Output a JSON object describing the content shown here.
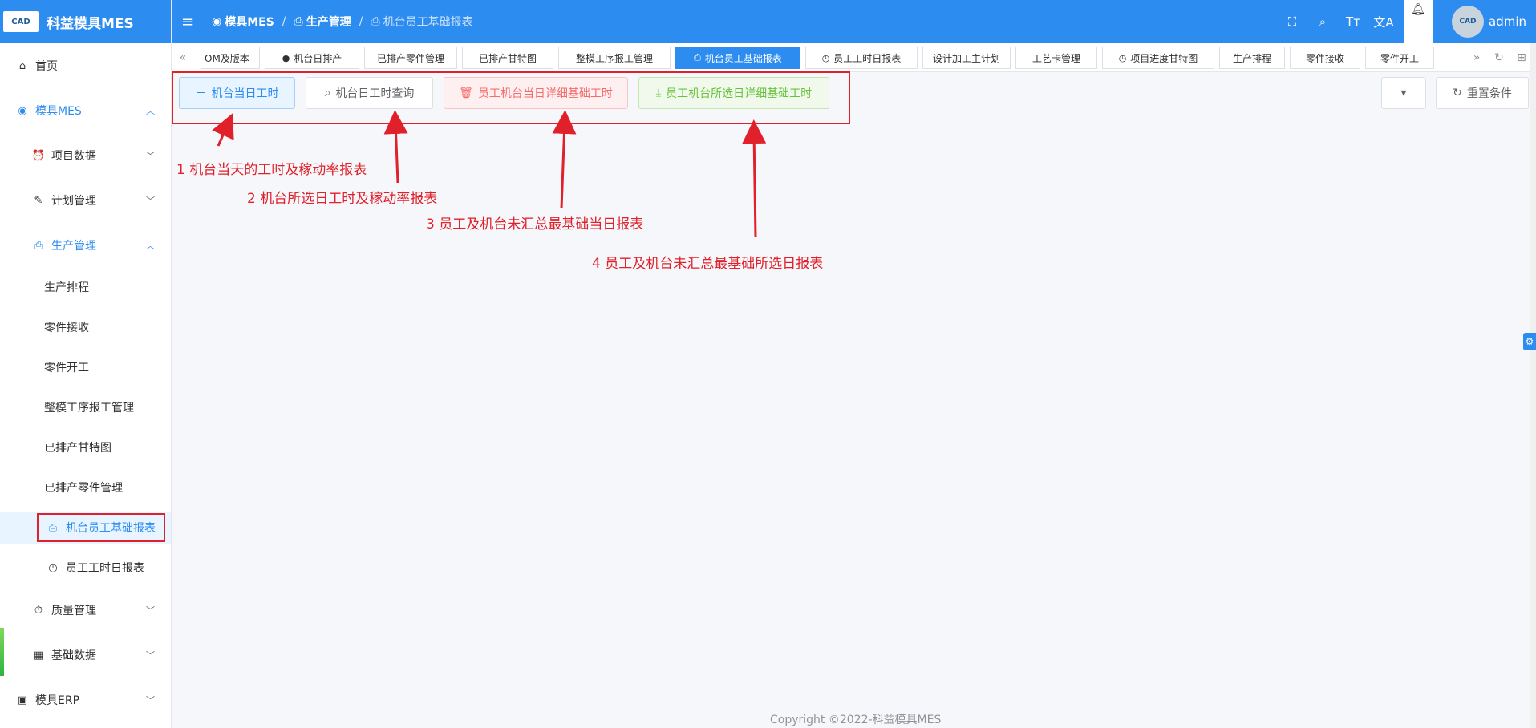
{
  "app": {
    "logo_text": "CAD",
    "title": "科益模具MES"
  },
  "breadcrumb": {
    "c1": "模具MES",
    "c2": "生产管理",
    "c3": "机台员工基础报表"
  },
  "user": {
    "avatar_text": "CAD",
    "name": "admin"
  },
  "sidebar": {
    "home": "首页",
    "mes": "模具MES",
    "project_data": "项目数据",
    "plan_mgmt": "计划管理",
    "production_mgmt": "生产管理",
    "sub": {
      "s1": "生产排程",
      "s2": "零件接收",
      "s3": "零件开工",
      "s4": "整模工序报工管理",
      "s5": "已排产甘特图",
      "s6": "已排产零件管理",
      "s7": "机台员工基础报表",
      "s8": "员工工时日报表"
    },
    "quality": "质量管理",
    "basic_data": "基础数据",
    "erp": "模具ERP"
  },
  "tabs": {
    "t1": "OM及版本",
    "t2": "机台日排产",
    "t3": "已排产零件管理",
    "t4": "已排产甘特图",
    "t5": "整模工序报工管理",
    "t6": "机台员工基础报表",
    "t7": "员工工时日报表",
    "t8": "设计加工主计划",
    "t9": "工艺卡管理",
    "t10": "项目进度甘特图",
    "t11": "生产排程",
    "t12": "零件接收",
    "t13": "零件开工"
  },
  "toolbar": {
    "b1": "机台当日工时",
    "b2": "机台日工时查询",
    "b3": "员工机台当日详细基础工时",
    "b4": "员工机台所选日详细基础工时",
    "reset": "重置条件"
  },
  "annotations": {
    "a1": "1 机台当天的工时及稼动率报表",
    "a2": "2 机台所选日工时及稼动率报表",
    "a3": "3 员工及机台未汇总最基础当日报表",
    "a4": "4 员工及机台未汇总最基础所选日报表"
  },
  "footer": "Copyright ©2022-科益模具MES",
  "colors": {
    "primary": "#2d8cf0",
    "annotation": "#e0202a"
  }
}
